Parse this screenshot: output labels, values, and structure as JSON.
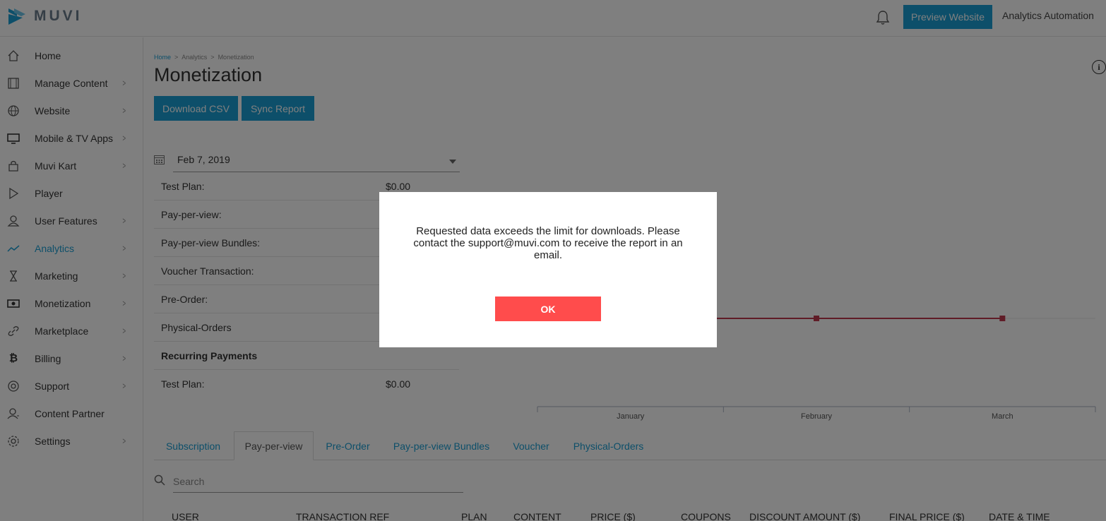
{
  "header": {
    "logo_text": "MUVI",
    "preview_label": "Preview Website",
    "user_name": "Analytics Automation"
  },
  "sidebar": {
    "items": [
      {
        "label": "Home",
        "icon": "home-icon",
        "chevron": ""
      },
      {
        "label": "Manage Content",
        "icon": "film-icon",
        "chevron": ">"
      },
      {
        "label": "Website",
        "icon": "globe-icon",
        "chevron": ">"
      },
      {
        "label": "Mobile & TV Apps",
        "icon": "monitor-icon",
        "chevron": ">"
      },
      {
        "label": "Muvi Kart",
        "icon": "bag-icon",
        "chevron": ">"
      },
      {
        "label": "Player",
        "icon": "play-icon",
        "chevron": ""
      },
      {
        "label": "User Features",
        "icon": "user-icon",
        "chevron": ">"
      },
      {
        "label": "Analytics",
        "icon": "chart-line-icon",
        "chevron": ">"
      },
      {
        "label": "Marketing",
        "icon": "hourglass-icon",
        "chevron": ">"
      },
      {
        "label": "Monetization",
        "icon": "cash-icon",
        "chevron": ">"
      },
      {
        "label": "Marketplace",
        "icon": "link-icon",
        "chevron": ">"
      },
      {
        "label": "Billing",
        "icon": "bitcoin-icon",
        "chevron": ">"
      },
      {
        "label": "Support",
        "icon": "lifebuoy-icon",
        "chevron": ">"
      },
      {
        "label": "Content Partner",
        "icon": "partner-icon",
        "chevron": ""
      },
      {
        "label": "Settings",
        "icon": "gear-icon",
        "chevron": ">"
      }
    ]
  },
  "breadcrumb": {
    "home": "Home",
    "sep": ">",
    "analytics": "Analytics",
    "current": "Monetization"
  },
  "page": {
    "title": "Monetization",
    "download_label": "Download CSV",
    "sync_label": "Sync Report",
    "date_value": "Feb 7, 2019"
  },
  "summary": [
    {
      "label": "Test Plan:",
      "value": "$0.00",
      "bold": false
    },
    {
      "label": "Pay-per-view:",
      "value": "",
      "bold": false
    },
    {
      "label": "Pay-per-view Bundles:",
      "value": "",
      "bold": false
    },
    {
      "label": "Voucher Transaction:",
      "value": "",
      "bold": false
    },
    {
      "label": "Pre-Order:",
      "value": "",
      "bold": false
    },
    {
      "label": "Physical-Orders",
      "value": "",
      "bold": false
    },
    {
      "label": "Recurring Payments",
      "value": "",
      "bold": true
    },
    {
      "label": "Test Plan:",
      "value": "$0.00",
      "bold": false
    }
  ],
  "chart_data": {
    "type": "line",
    "categories": [
      "January",
      "February",
      "March"
    ],
    "series": [
      {
        "values": [
          0,
          0,
          0
        ],
        "color": "#c0394f"
      }
    ]
  },
  "tabs": [
    {
      "label": "Subscription"
    },
    {
      "label": "Pay-per-view"
    },
    {
      "label": "Pre-Order"
    },
    {
      "label": "Pay-per-view Bundles"
    },
    {
      "label": "Voucher"
    },
    {
      "label": "Physical-Orders"
    }
  ],
  "active_tab": "Pay-per-view",
  "search": {
    "placeholder": "Search"
  },
  "table": {
    "columns": [
      "USER",
      "TRANSACTION REF",
      "PLAN",
      "CONTENT",
      "PRICE ($)",
      "COUPONS",
      "DISCOUNT AMOUNT ($)",
      "FINAL PRICE ($)",
      "DATE & TIME"
    ]
  },
  "modal": {
    "message": "Requested data exceeds the limit for downloads. Please contact the support@muvi.com to receive the report in an email.",
    "ok_label": "OK"
  },
  "colors": {
    "accent": "#1a9fd4",
    "danger": "#ff4c4c",
    "line": "#c0394f"
  }
}
